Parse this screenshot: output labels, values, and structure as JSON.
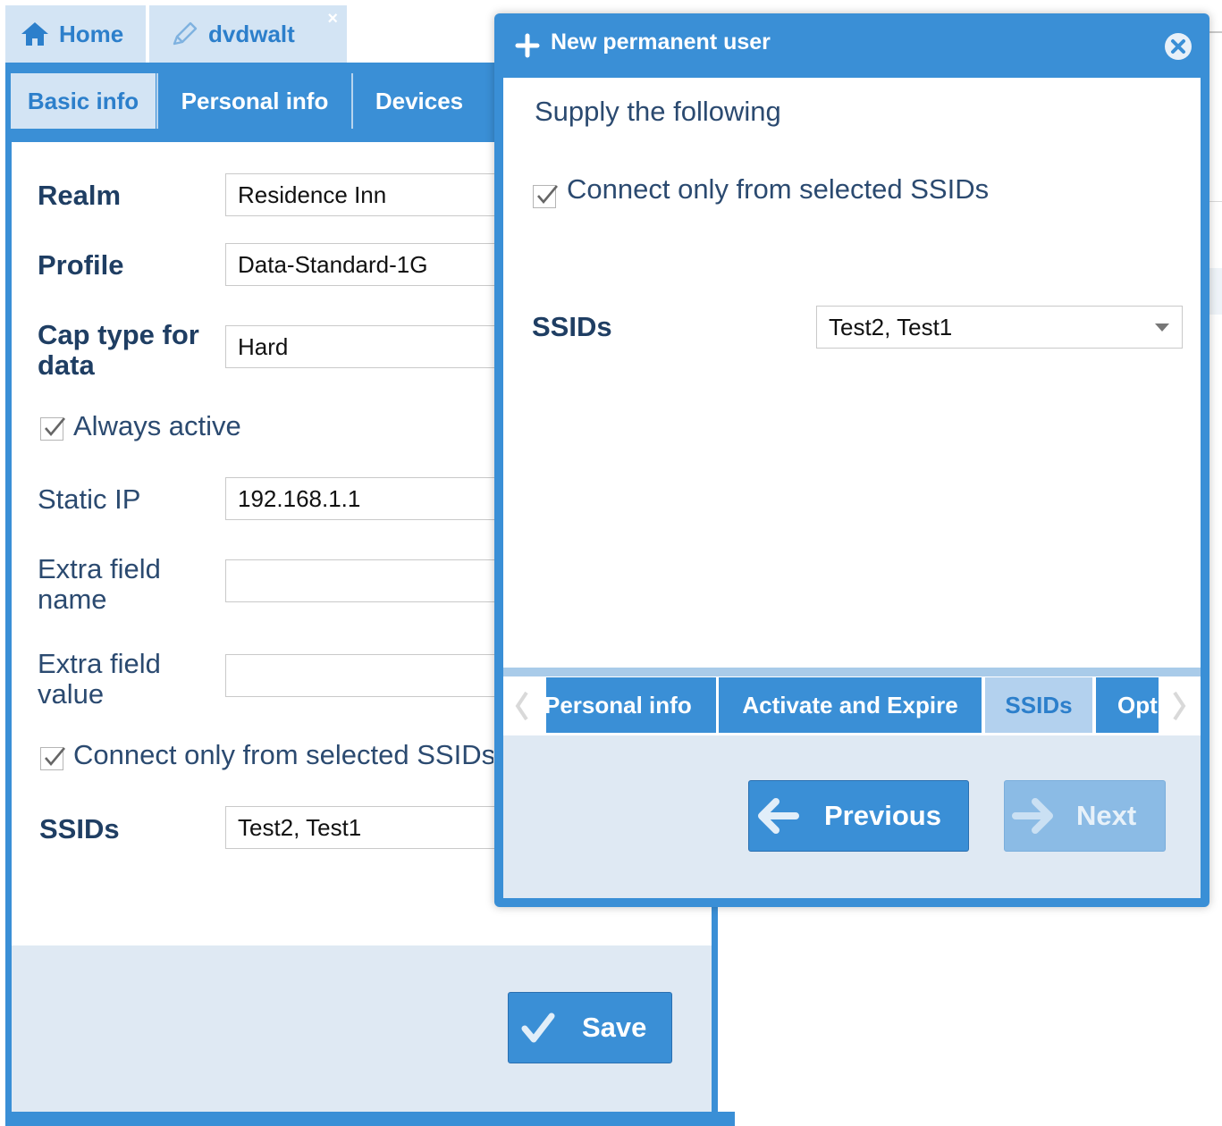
{
  "top_tabs": [
    {
      "label": "Home",
      "icon": "home-icon"
    },
    {
      "label": "dvdwalt",
      "icon": "pencil-icon",
      "close": "×"
    }
  ],
  "inner_tabs": [
    {
      "label": "Basic info"
    },
    {
      "label": "Personal info"
    },
    {
      "label": "Devices"
    }
  ],
  "form": {
    "realm_label": "Realm",
    "realm_value": "Residence Inn",
    "profile_label": "Profile",
    "profile_value": "Data-Standard-1G",
    "cap_label_1": "Cap type for",
    "cap_label_2": "data",
    "cap_value": "Hard",
    "always_active_label": "Always active",
    "always_active_checked": true,
    "static_ip_label": "Static IP",
    "static_ip_value": "192.168.1.1",
    "extra_name_label_1": "Extra field",
    "extra_name_label_2": "name",
    "extra_name_value": "",
    "extra_value_label_1": "Extra field",
    "extra_value_label_2": "value",
    "extra_value_value": "",
    "connect_ssid_label": "Connect only from selected SSIDs",
    "connect_ssid_checked": true,
    "ssids_label": "SSIDs",
    "ssids_value": "Test2, Test1",
    "save_label": "Save"
  },
  "dialog": {
    "title": "New permanent user",
    "instruction": "Supply the following",
    "connect_ssid_label": "Connect only from selected SSIDs",
    "connect_ssid_checked": true,
    "ssids_label": "SSIDs",
    "ssids_value": "Test2, Test1",
    "tabs": [
      {
        "label": "Personal info"
      },
      {
        "label": "Activate and Expire"
      },
      {
        "label": "SSIDs"
      },
      {
        "label": "Opt"
      }
    ],
    "active_tab": "SSIDs",
    "prev_label": "Previous",
    "next_label": "Next",
    "next_enabled": false
  },
  "colors": {
    "accent": "#3a8fd6",
    "active_tab_bg": "#d3e4f4",
    "footer_bg": "#dfe9f3",
    "label_text": "#1f3e63"
  }
}
